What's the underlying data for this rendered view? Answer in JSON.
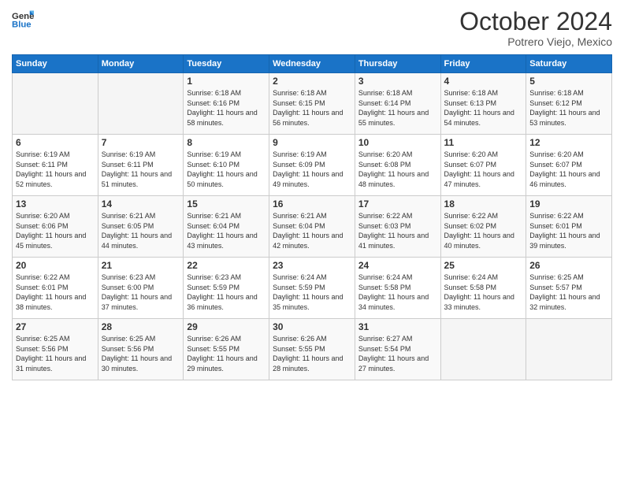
{
  "logo": {
    "line1": "General",
    "line2": "Blue"
  },
  "title": "October 2024",
  "location": "Potrero Viejo, Mexico",
  "days_of_week": [
    "Sunday",
    "Monday",
    "Tuesday",
    "Wednesday",
    "Thursday",
    "Friday",
    "Saturday"
  ],
  "weeks": [
    [
      {
        "day": "",
        "sunrise": "",
        "sunset": "",
        "daylight": ""
      },
      {
        "day": "",
        "sunrise": "",
        "sunset": "",
        "daylight": ""
      },
      {
        "day": "1",
        "sunrise": "Sunrise: 6:18 AM",
        "sunset": "Sunset: 6:16 PM",
        "daylight": "Daylight: 11 hours and 58 minutes."
      },
      {
        "day": "2",
        "sunrise": "Sunrise: 6:18 AM",
        "sunset": "Sunset: 6:15 PM",
        "daylight": "Daylight: 11 hours and 56 minutes."
      },
      {
        "day": "3",
        "sunrise": "Sunrise: 6:18 AM",
        "sunset": "Sunset: 6:14 PM",
        "daylight": "Daylight: 11 hours and 55 minutes."
      },
      {
        "day": "4",
        "sunrise": "Sunrise: 6:18 AM",
        "sunset": "Sunset: 6:13 PM",
        "daylight": "Daylight: 11 hours and 54 minutes."
      },
      {
        "day": "5",
        "sunrise": "Sunrise: 6:18 AM",
        "sunset": "Sunset: 6:12 PM",
        "daylight": "Daylight: 11 hours and 53 minutes."
      }
    ],
    [
      {
        "day": "6",
        "sunrise": "Sunrise: 6:19 AM",
        "sunset": "Sunset: 6:11 PM",
        "daylight": "Daylight: 11 hours and 52 minutes."
      },
      {
        "day": "7",
        "sunrise": "Sunrise: 6:19 AM",
        "sunset": "Sunset: 6:11 PM",
        "daylight": "Daylight: 11 hours and 51 minutes."
      },
      {
        "day": "8",
        "sunrise": "Sunrise: 6:19 AM",
        "sunset": "Sunset: 6:10 PM",
        "daylight": "Daylight: 11 hours and 50 minutes."
      },
      {
        "day": "9",
        "sunrise": "Sunrise: 6:19 AM",
        "sunset": "Sunset: 6:09 PM",
        "daylight": "Daylight: 11 hours and 49 minutes."
      },
      {
        "day": "10",
        "sunrise": "Sunrise: 6:20 AM",
        "sunset": "Sunset: 6:08 PM",
        "daylight": "Daylight: 11 hours and 48 minutes."
      },
      {
        "day": "11",
        "sunrise": "Sunrise: 6:20 AM",
        "sunset": "Sunset: 6:07 PM",
        "daylight": "Daylight: 11 hours and 47 minutes."
      },
      {
        "day": "12",
        "sunrise": "Sunrise: 6:20 AM",
        "sunset": "Sunset: 6:07 PM",
        "daylight": "Daylight: 11 hours and 46 minutes."
      }
    ],
    [
      {
        "day": "13",
        "sunrise": "Sunrise: 6:20 AM",
        "sunset": "Sunset: 6:06 PM",
        "daylight": "Daylight: 11 hours and 45 minutes."
      },
      {
        "day": "14",
        "sunrise": "Sunrise: 6:21 AM",
        "sunset": "Sunset: 6:05 PM",
        "daylight": "Daylight: 11 hours and 44 minutes."
      },
      {
        "day": "15",
        "sunrise": "Sunrise: 6:21 AM",
        "sunset": "Sunset: 6:04 PM",
        "daylight": "Daylight: 11 hours and 43 minutes."
      },
      {
        "day": "16",
        "sunrise": "Sunrise: 6:21 AM",
        "sunset": "Sunset: 6:04 PM",
        "daylight": "Daylight: 11 hours and 42 minutes."
      },
      {
        "day": "17",
        "sunrise": "Sunrise: 6:22 AM",
        "sunset": "Sunset: 6:03 PM",
        "daylight": "Daylight: 11 hours and 41 minutes."
      },
      {
        "day": "18",
        "sunrise": "Sunrise: 6:22 AM",
        "sunset": "Sunset: 6:02 PM",
        "daylight": "Daylight: 11 hours and 40 minutes."
      },
      {
        "day": "19",
        "sunrise": "Sunrise: 6:22 AM",
        "sunset": "Sunset: 6:01 PM",
        "daylight": "Daylight: 11 hours and 39 minutes."
      }
    ],
    [
      {
        "day": "20",
        "sunrise": "Sunrise: 6:22 AM",
        "sunset": "Sunset: 6:01 PM",
        "daylight": "Daylight: 11 hours and 38 minutes."
      },
      {
        "day": "21",
        "sunrise": "Sunrise: 6:23 AM",
        "sunset": "Sunset: 6:00 PM",
        "daylight": "Daylight: 11 hours and 37 minutes."
      },
      {
        "day": "22",
        "sunrise": "Sunrise: 6:23 AM",
        "sunset": "Sunset: 5:59 PM",
        "daylight": "Daylight: 11 hours and 36 minutes."
      },
      {
        "day": "23",
        "sunrise": "Sunrise: 6:24 AM",
        "sunset": "Sunset: 5:59 PM",
        "daylight": "Daylight: 11 hours and 35 minutes."
      },
      {
        "day": "24",
        "sunrise": "Sunrise: 6:24 AM",
        "sunset": "Sunset: 5:58 PM",
        "daylight": "Daylight: 11 hours and 34 minutes."
      },
      {
        "day": "25",
        "sunrise": "Sunrise: 6:24 AM",
        "sunset": "Sunset: 5:58 PM",
        "daylight": "Daylight: 11 hours and 33 minutes."
      },
      {
        "day": "26",
        "sunrise": "Sunrise: 6:25 AM",
        "sunset": "Sunset: 5:57 PM",
        "daylight": "Daylight: 11 hours and 32 minutes."
      }
    ],
    [
      {
        "day": "27",
        "sunrise": "Sunrise: 6:25 AM",
        "sunset": "Sunset: 5:56 PM",
        "daylight": "Daylight: 11 hours and 31 minutes."
      },
      {
        "day": "28",
        "sunrise": "Sunrise: 6:25 AM",
        "sunset": "Sunset: 5:56 PM",
        "daylight": "Daylight: 11 hours and 30 minutes."
      },
      {
        "day": "29",
        "sunrise": "Sunrise: 6:26 AM",
        "sunset": "Sunset: 5:55 PM",
        "daylight": "Daylight: 11 hours and 29 minutes."
      },
      {
        "day": "30",
        "sunrise": "Sunrise: 6:26 AM",
        "sunset": "Sunset: 5:55 PM",
        "daylight": "Daylight: 11 hours and 28 minutes."
      },
      {
        "day": "31",
        "sunrise": "Sunrise: 6:27 AM",
        "sunset": "Sunset: 5:54 PM",
        "daylight": "Daylight: 11 hours and 27 minutes."
      },
      {
        "day": "",
        "sunrise": "",
        "sunset": "",
        "daylight": ""
      },
      {
        "day": "",
        "sunrise": "",
        "sunset": "",
        "daylight": ""
      }
    ]
  ]
}
